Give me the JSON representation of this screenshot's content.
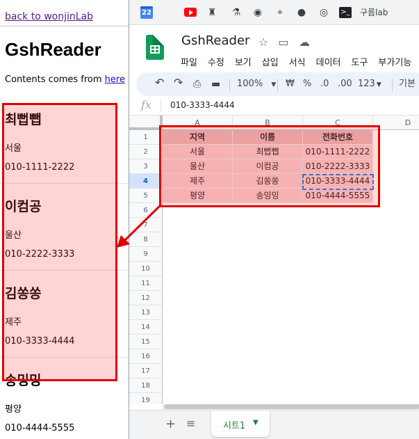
{
  "left_page": {
    "back_link": "back to wonjinLab",
    "title": "GshReader",
    "intro_prefix": "Contents comes from ",
    "intro_link": "here",
    "contacts": [
      {
        "name": "최뻡뺍",
        "city": "서울",
        "phone": "010-1111-2222"
      },
      {
        "name": "이컴공",
        "city": "울산",
        "phone": "010-2222-3333"
      },
      {
        "name": "김쏭쏭",
        "city": "제주",
        "phone": "010-3333-4444"
      },
      {
        "name": "송밍밍",
        "city": "평양",
        "phone": "010-4444-5555"
      }
    ]
  },
  "bookmarks": [
    {
      "icon": "calendar-icon",
      "text": "22"
    },
    {
      "icon": "youtube-icon",
      "text": ""
    },
    {
      "icon": "chess-rook-icon",
      "text": "♜"
    },
    {
      "icon": "microscope-icon",
      "text": "⚗"
    },
    {
      "icon": "globe-icon",
      "text": "◉"
    },
    {
      "icon": "map-pin-icon",
      "text": "⌖"
    },
    {
      "icon": "github-icon",
      "text": "●"
    },
    {
      "icon": "spiral-icon",
      "text": "◎"
    },
    {
      "icon": "terminal-icon",
      "text": ">_"
    },
    {
      "icon": "goorm-icon",
      "text": "구름lab"
    }
  ],
  "sheets": {
    "doc_title": "GshReader",
    "menu": [
      "파일",
      "수정",
      "보기",
      "삽입",
      "서식",
      "데이터",
      "도구",
      "부가기능"
    ],
    "toolbar": {
      "zoom": "100%",
      "currency": "₩",
      "percent": "%",
      "dec_less": ".0",
      "dec_more": ".00",
      "number_format": "123",
      "font": "기본"
    },
    "formula_value": "010-3333-4444",
    "columns": [
      "A",
      "B",
      "C",
      "D"
    ],
    "rows": [
      "1",
      "2",
      "3",
      "4",
      "5",
      "6",
      "7",
      "8",
      "9",
      "10",
      "11",
      "12",
      "13",
      "14",
      "15",
      "16",
      "17",
      "18",
      "19"
    ],
    "table_header": [
      "지역",
      "이름",
      "전화번호"
    ],
    "table_rows": [
      [
        "서울",
        "최뻡뺍",
        "010-1111-2222"
      ],
      [
        "울산",
        "이컴공",
        "010-2222-3333"
      ],
      [
        "제주",
        "김쏭쏭",
        "010-3333-4444"
      ],
      [
        "평양",
        "송밍밍",
        "010-4444-5555"
      ]
    ],
    "active_row": "4",
    "sheet_tab": "시트1"
  },
  "colors": {
    "highlight_red": "#e00000",
    "header_fill": "#e6b8b7",
    "data_fill": "#f4cccc",
    "sheets_green": "#0f9d58",
    "selection_blue": "#1a73e8"
  }
}
